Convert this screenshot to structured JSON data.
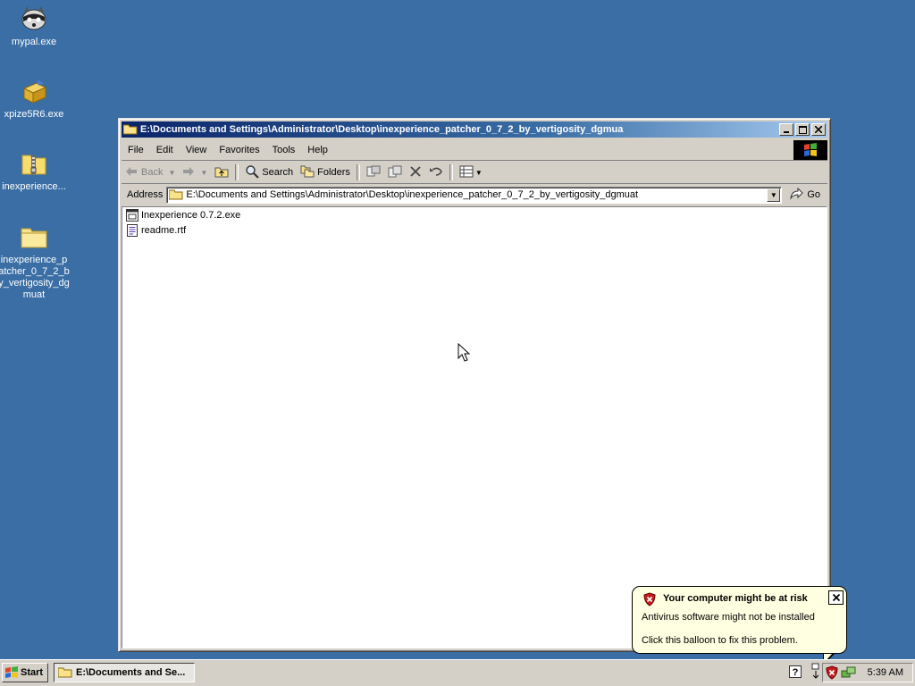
{
  "desktop": {
    "icons": [
      {
        "label": "mypal.exe",
        "icon": "raccoon-icon"
      },
      {
        "label": "xpize5R6.exe",
        "icon": "installer-box-icon"
      },
      {
        "label": "inexperience...",
        "icon": "zip-folder-icon"
      },
      {
        "label": "inexperience_patcher_0_7_2_by_vertigosity_dgmuat",
        "icon": "folder-icon"
      }
    ]
  },
  "window": {
    "title": "E:\\Documents and Settings\\Administrator\\Desktop\\inexperience_patcher_0_7_2_by_vertigosity_dgmua",
    "menu": [
      "File",
      "Edit",
      "View",
      "Favorites",
      "Tools",
      "Help"
    ],
    "toolbar": {
      "back": "Back",
      "search": "Search",
      "folders": "Folders"
    },
    "address": {
      "label": "Address",
      "value": "E:\\Documents and Settings\\Administrator\\Desktop\\inexperience_patcher_0_7_2_by_vertigosity_dgmuat",
      "go": "Go"
    },
    "files": [
      {
        "name": "Inexperience 0.7.2.exe",
        "icon": "exe-icon"
      },
      {
        "name": "readme.rtf",
        "icon": "rtf-document-icon"
      }
    ]
  },
  "taskbar": {
    "start": "Start",
    "task": "E:\\Documents and Se...",
    "clock": "5:39 AM"
  },
  "balloon": {
    "title": "Your computer might be at risk",
    "line1": "Antivirus software might not be installed",
    "line2": "Click this balloon to fix this problem."
  },
  "colors": {
    "desktop": "#3a6ea5",
    "title_active": "#0a246a",
    "balloon_bg": "#ffffe1"
  }
}
